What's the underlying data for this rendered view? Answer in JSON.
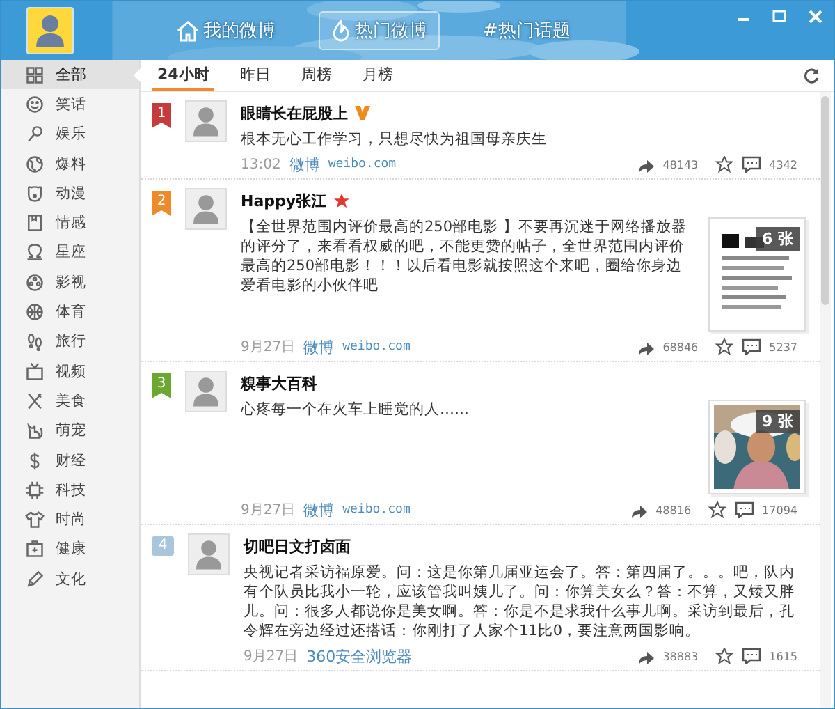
{
  "header": {
    "nav": [
      {
        "label": "我的微博",
        "selected": false
      },
      {
        "label": "热门微博",
        "selected": true
      },
      {
        "label": "#热门话题",
        "selected": false
      }
    ]
  },
  "sidebar": {
    "items": [
      {
        "label": "全部",
        "selected": true
      },
      {
        "label": "笑话",
        "selected": false
      },
      {
        "label": "娱乐",
        "selected": false
      },
      {
        "label": "爆料",
        "selected": false
      },
      {
        "label": "动漫",
        "selected": false
      },
      {
        "label": "情感",
        "selected": false
      },
      {
        "label": "星座",
        "selected": false
      },
      {
        "label": "影视",
        "selected": false
      },
      {
        "label": "体育",
        "selected": false
      },
      {
        "label": "旅行",
        "selected": false
      },
      {
        "label": "视频",
        "selected": false
      },
      {
        "label": "美食",
        "selected": false
      },
      {
        "label": "萌宠",
        "selected": false
      },
      {
        "label": "财经",
        "selected": false
      },
      {
        "label": "科技",
        "selected": false
      },
      {
        "label": "时尚",
        "selected": false
      },
      {
        "label": "健康",
        "selected": false
      },
      {
        "label": "文化",
        "selected": false
      }
    ]
  },
  "tabs": [
    {
      "label": "24小时",
      "selected": true
    },
    {
      "label": "昨日",
      "selected": false
    },
    {
      "label": "周榜",
      "selected": false
    },
    {
      "label": "月榜",
      "selected": false
    }
  ],
  "posts": [
    {
      "rank": "1",
      "color": "#c43c3c",
      "author": "眼睛长在屁股上",
      "kind": "verified",
      "text": "根本无心工作学习，只想尽快为祖国母亲庆生",
      "time": "13:02",
      "source": "微博",
      "source_url": "weibo.com",
      "reposts": "48143",
      "comments": "4342"
    },
    {
      "rank": "2",
      "color": "#ef8a2a",
      "author": "Happy张江",
      "kind": "star",
      "text": "【全世界范围内评价最高的250部电影 】不要再沉迷于网络播放器的评分了，来看看权威的吧，不能更赞的帖子，全世界范围内评价最高的250部电影！！！以后看电影就按照这个来吧，圈给你身边爱看电影的小伙伴吧",
      "time": "9月27日",
      "source": "微博",
      "source_url": "weibo.com",
      "reposts": "68846",
      "comments": "5237",
      "image": {
        "count": "6 张",
        "kind": "picture"
      }
    },
    {
      "rank": "3",
      "color": "#6aa832",
      "author": "糗事大百科",
      "text": "心疼每一个在火车上睡觉的人……",
      "time": "9月27日",
      "source": "微博",
      "source_url": "weibo.com",
      "reposts": "48816",
      "comments": "17094",
      "image": {
        "count": "9 张",
        "kind": "picture"
      }
    },
    {
      "rank": "4",
      "color": "#a9c6dd",
      "author": "切吧日文打卤面",
      "text": "央视记者采访福原爱。问：这是你第几届亚运会了。答：第四届了。。。吧，队内有个队员比我小一轮，应该管我叫姨儿了。问：你算美女么？答：不算，又矮又胖儿。问：很多人都说你是美女啊。答：你是不是求我什么事儿啊。采访到最后，孔令辉在旁边经过还搭话：你刚打了人家个11比0，要注意两国影响。",
      "time": "9月27日",
      "source": "360安全浏览器",
      "reposts": "38883",
      "comments": "1615"
    }
  ]
}
